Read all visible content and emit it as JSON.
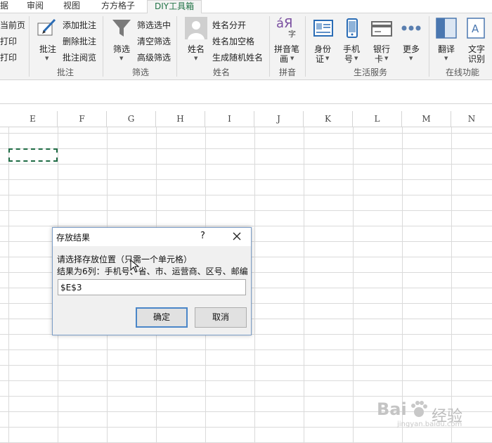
{
  "tabs": [
    "据",
    "审阅",
    "视图",
    "方方格子",
    "DIY工具箱"
  ],
  "ribbon": {
    "print": {
      "items": [
        "当前页",
        "打印",
        "打印"
      ]
    },
    "comment": {
      "main_label": "批注",
      "items": [
        "添加批注",
        "删除批注",
        "批注阅览"
      ],
      "group_label": "批注"
    },
    "filter": {
      "main_label": "筛选",
      "items": [
        "筛选选中",
        "清空筛选",
        "高级筛选"
      ],
      "group_label": "筛选"
    },
    "name": {
      "main_label": "姓名",
      "items": [
        "姓名分开",
        "姓名加空格",
        "生成随机姓名"
      ],
      "group_label": "姓名"
    },
    "pinyin": {
      "icon_glyph": "áЯ",
      "icon_sub": "字",
      "main_label_1": "拼音笔",
      "main_label_2": "画",
      "group_label": "拼音"
    },
    "life": {
      "buttons": [
        {
          "l1": "身份",
          "l2": "证"
        },
        {
          "l1": "手机",
          "l2": "号"
        },
        {
          "l1": "银行",
          "l2": "卡"
        },
        {
          "l1": "更多",
          "l2": ""
        }
      ],
      "group_label": "生活服务"
    },
    "online": {
      "buttons": [
        {
          "l1": "翻译",
          "l2": ""
        },
        {
          "l1": "文字",
          "l2": "识别"
        }
      ],
      "group_label": "在线功能"
    }
  },
  "columns": [
    "E",
    "F",
    "G",
    "H",
    "I",
    "J",
    "K",
    "L",
    "M",
    "N"
  ],
  "dialog": {
    "title": "存放结果",
    "help": "?",
    "line1": "请选择存放位置（只需一个单元格）",
    "line2": "结果为6列：手机号、省、市、运营商、区号、邮编",
    "input_value": "$E$3",
    "ok_label": "确定",
    "cancel_label": "取消"
  },
  "watermark": {
    "brand": "Bai",
    "brand2": "经验",
    "url": "jingyan.baidu.com"
  }
}
